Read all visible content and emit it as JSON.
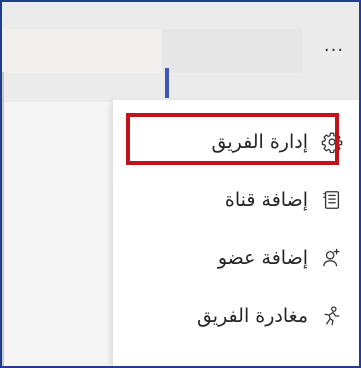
{
  "header": {
    "more_label": "···"
  },
  "menu": {
    "items": [
      {
        "label": "إدارة الفريق",
        "icon": "gear-icon"
      },
      {
        "label": "إضافة قناة",
        "icon": "channel-list-icon"
      },
      {
        "label": "إضافة عضو",
        "icon": "add-person-icon"
      },
      {
        "label": "مغادرة الفريق",
        "icon": "leave-person-icon"
      }
    ]
  },
  "colors": {
    "highlight_border": "#c0131a",
    "frame_border": "#1f3d8a",
    "text": "#252525"
  }
}
